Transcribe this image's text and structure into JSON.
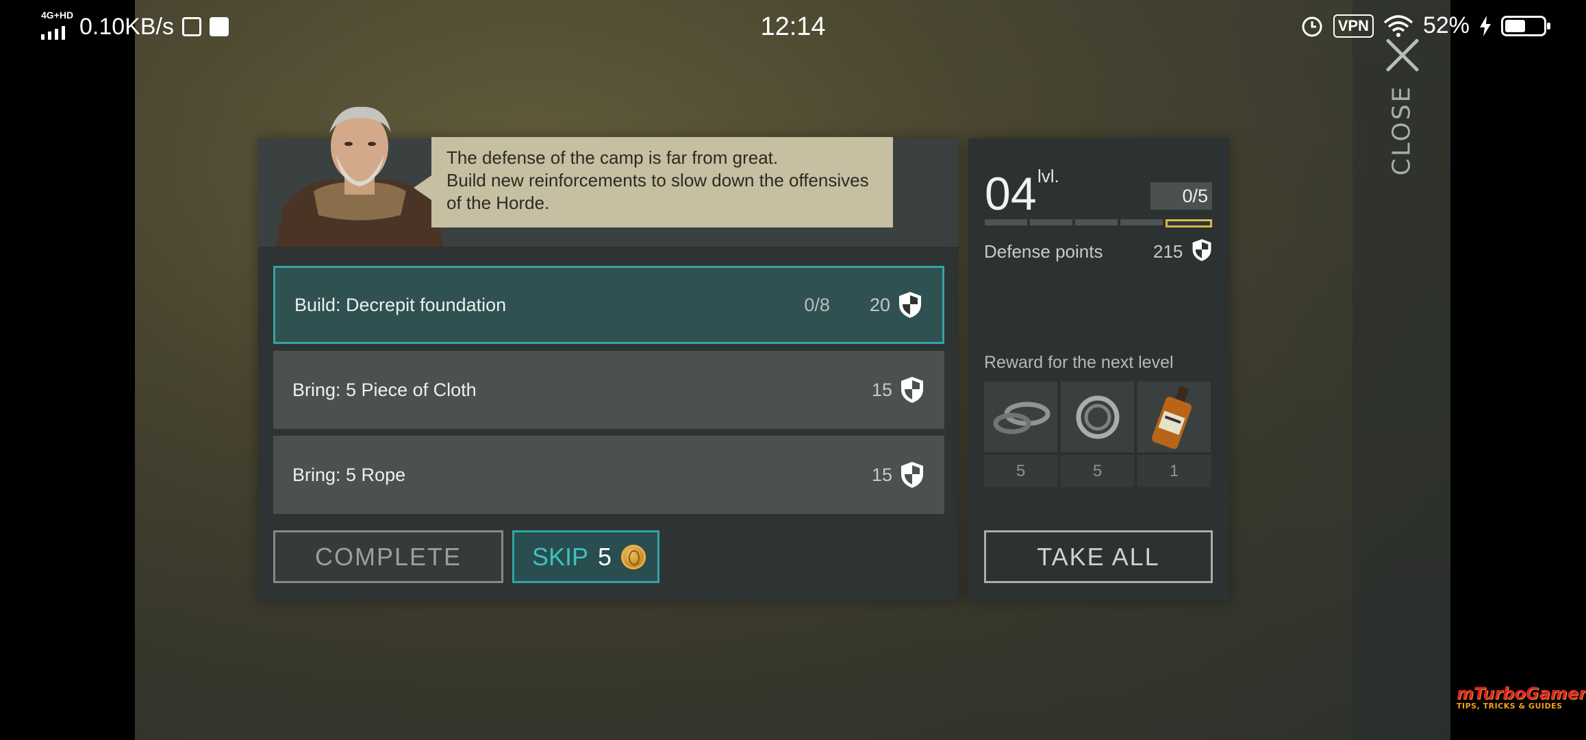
{
  "status_bar": {
    "network": "4G+HD",
    "speed": "0.10KB/s",
    "time": "12:14",
    "vpn": "VPN",
    "battery": "52%"
  },
  "close_label": "CLOSE",
  "dialog": {
    "line1": "The defense of the camp is far from great.",
    "line2": "Build new reinforcements to slow down the offensives",
    "line3": "of the Horde."
  },
  "tasks": [
    {
      "label": "Build: Decrepit foundation",
      "progress": "0/8",
      "points": "20",
      "active": true
    },
    {
      "label": "Bring: 5 Piece of Cloth",
      "progress": "",
      "points": "15",
      "active": false
    },
    {
      "label": "Bring: 5 Rope",
      "progress": "",
      "points": "15",
      "active": false
    }
  ],
  "buttons": {
    "complete": "COMPLETE",
    "skip": "SKIP",
    "skip_cost": "5",
    "take_all": "TAKE ALL"
  },
  "level": {
    "number": "04",
    "unit": "lvl.",
    "progress_text": "0/5",
    "segments_total": 5,
    "segments_done": 4,
    "defense_label": "Defense points",
    "defense_value": "215"
  },
  "reward_label": "Reward for the next level",
  "rewards": [
    {
      "icon": "washers-icon",
      "qty": "5"
    },
    {
      "icon": "bearing-icon",
      "qty": "5"
    },
    {
      "icon": "whiskey-bottle-icon",
      "qty": "1"
    }
  ],
  "watermark": {
    "line1": "mTurboGamer",
    "line2": "TIPS, TRICKS & GUIDES"
  },
  "colors": {
    "accent_teal": "#37a3a2",
    "progress_gold": "#d6b84e",
    "speech_bg": "#c6bfa2"
  }
}
